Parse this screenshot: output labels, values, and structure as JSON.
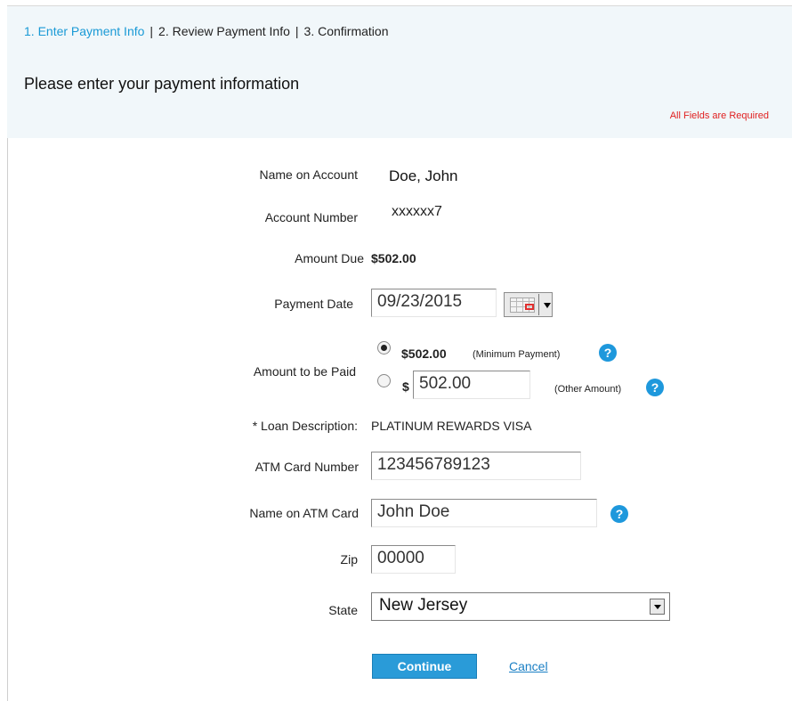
{
  "steps": {
    "step1": "1. Enter Payment Info",
    "step2": "2. Review Payment Info",
    "step3": "3. Confirmation",
    "separator": "|"
  },
  "heading": "Please enter your payment information",
  "required_note": "All Fields are Required",
  "form": {
    "name_on_account": {
      "label": "Name on Account",
      "value": "Doe, John"
    },
    "account_number": {
      "label": "Account Number",
      "value": "xxxxxx7"
    },
    "amount_due": {
      "label": "Amount Due",
      "value": "$502.00"
    },
    "payment_date": {
      "label": "Payment Date",
      "value": "09/23/2015"
    },
    "amount_to_be_paid": {
      "label": "Amount to be Paid",
      "minimum_value": "$502.00",
      "minimum_note": "(Minimum Payment)",
      "currency_symbol": "$",
      "other_value": "502.00",
      "other_note": "(Other Amount)"
    },
    "loan_description": {
      "label": "* Loan Description:",
      "value": "PLATINUM REWARDS VISA"
    },
    "atm_card_number": {
      "label": "ATM Card Number",
      "value": "123456789123"
    },
    "name_on_atm_card": {
      "label": "Name on ATM Card",
      "value": "John Doe"
    },
    "zip": {
      "label": "Zip",
      "value": "00000"
    },
    "state": {
      "label": "State",
      "value": "New Jersey"
    }
  },
  "help_glyph": "?",
  "buttons": {
    "continue": "Continue",
    "cancel": "Cancel"
  },
  "colors": {
    "accent": "#1a9ad6",
    "required": "#e02020",
    "help": "#1e98dc"
  }
}
